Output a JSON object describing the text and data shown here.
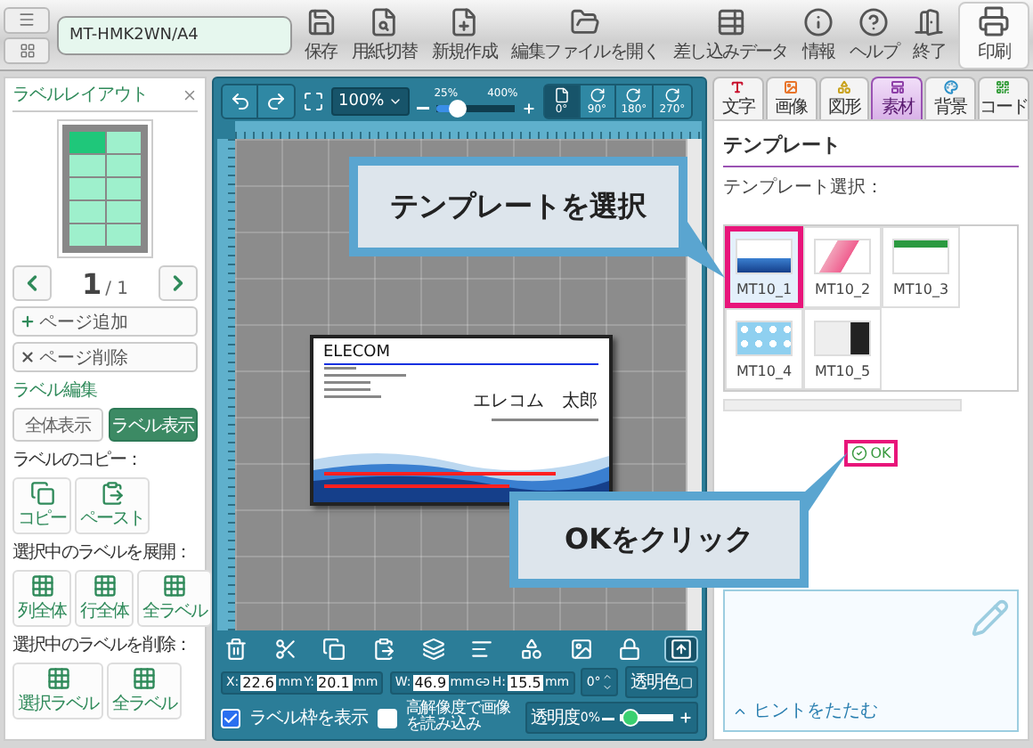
{
  "toolbar": {
    "file_name": "MT-HMK2WN/A4",
    "buttons": [
      "保存",
      "用紙切替",
      "新規作成",
      "編集ファイルを開く",
      "差し込みデータ",
      "情報",
      "ヘルプ",
      "終了"
    ],
    "print": "印刷"
  },
  "left_panel": {
    "title": "ラベルレイアウト",
    "layout_cells": [
      {
        "selected": true
      },
      {
        "selected": false
      },
      {
        "selected": false
      },
      {
        "selected": false
      },
      {
        "selected": false
      },
      {
        "selected": false
      },
      {
        "selected": false
      },
      {
        "selected": false
      },
      {
        "selected": false
      },
      {
        "selected": false
      }
    ],
    "page_current": "1",
    "page_total": "/ 1",
    "page_buttons": [
      "ページ追加",
      "ページ削除"
    ],
    "edit_title": "ラベル編集",
    "views": [
      {
        "label": "全体表示",
        "selected": false
      },
      {
        "label": "ラベル表示",
        "selected": true
      }
    ],
    "groups": [
      {
        "title": "ラベルのコピー：",
        "buttons": [
          "コピー",
          "ペースト"
        ]
      },
      {
        "title": "選択中のラベルを展開：",
        "buttons": [
          "列全体",
          "行全体",
          "全ラベル"
        ]
      },
      {
        "title": "選択中のラベルを削除：",
        "buttons": [
          "選択ラベル",
          "全ラベル"
        ]
      }
    ]
  },
  "canvas": {
    "zoom": "100%",
    "zoom_min": "25%",
    "zoom_max": "400%",
    "zoom_slider": {
      "level": 0.2
    },
    "rotations": [
      {
        "label": "0°",
        "selected": true
      },
      {
        "label": "90°",
        "selected": false
      },
      {
        "label": "180°",
        "selected": false
      },
      {
        "label": "270°",
        "selected": false
      }
    ],
    "card": {
      "company": "ELECOM",
      "name": "エレコム　太郎"
    }
  },
  "properties": {
    "fields": [
      {
        "label": "X:",
        "value": "22.6",
        "unit": "mm"
      },
      {
        "label": "Y:",
        "value": "20.1",
        "unit": "mm"
      },
      {
        "label": "W:",
        "value": "46.9",
        "unit": "mm"
      },
      {
        "label": "H:",
        "value": "15.5",
        "unit": "mm"
      }
    ],
    "rotation": "0°",
    "transparent_color": "透明色",
    "checkboxes": [
      {
        "label": "ラベル枠を表示",
        "checked": true
      },
      {
        "label": "高解像度で画像を読み込み",
        "checked": false
      }
    ],
    "opacity": {
      "label": "透明度",
      "value": "0%",
      "level": 0.05
    }
  },
  "right_panel": {
    "tabs": [
      {
        "label": "文字",
        "color": "#c8102e",
        "selected": false
      },
      {
        "label": "画像",
        "color": "#e8742a",
        "selected": false
      },
      {
        "label": "図形",
        "color": "#c9a21c",
        "selected": false
      },
      {
        "label": "素材",
        "color": "#8e3fa8",
        "selected": true
      },
      {
        "label": "背景",
        "color": "#2a8fc8",
        "selected": false
      },
      {
        "label": "コード",
        "color": "#3aa040",
        "selected": false
      }
    ],
    "heading": "テンプレート",
    "subheading": "テンプレート選択：",
    "templates": [
      {
        "label": "MT10_1",
        "selected": true
      },
      {
        "label": "MT10_2",
        "selected": false
      },
      {
        "label": "MT10_3",
        "selected": false
      },
      {
        "label": "MT10_4",
        "selected": false
      },
      {
        "label": "MT10_5",
        "selected": false
      }
    ],
    "ok": "OK",
    "hint": "ヒントをたたむ"
  },
  "callouts": [
    "テンプレートを選択",
    "OKをクリック"
  ]
}
